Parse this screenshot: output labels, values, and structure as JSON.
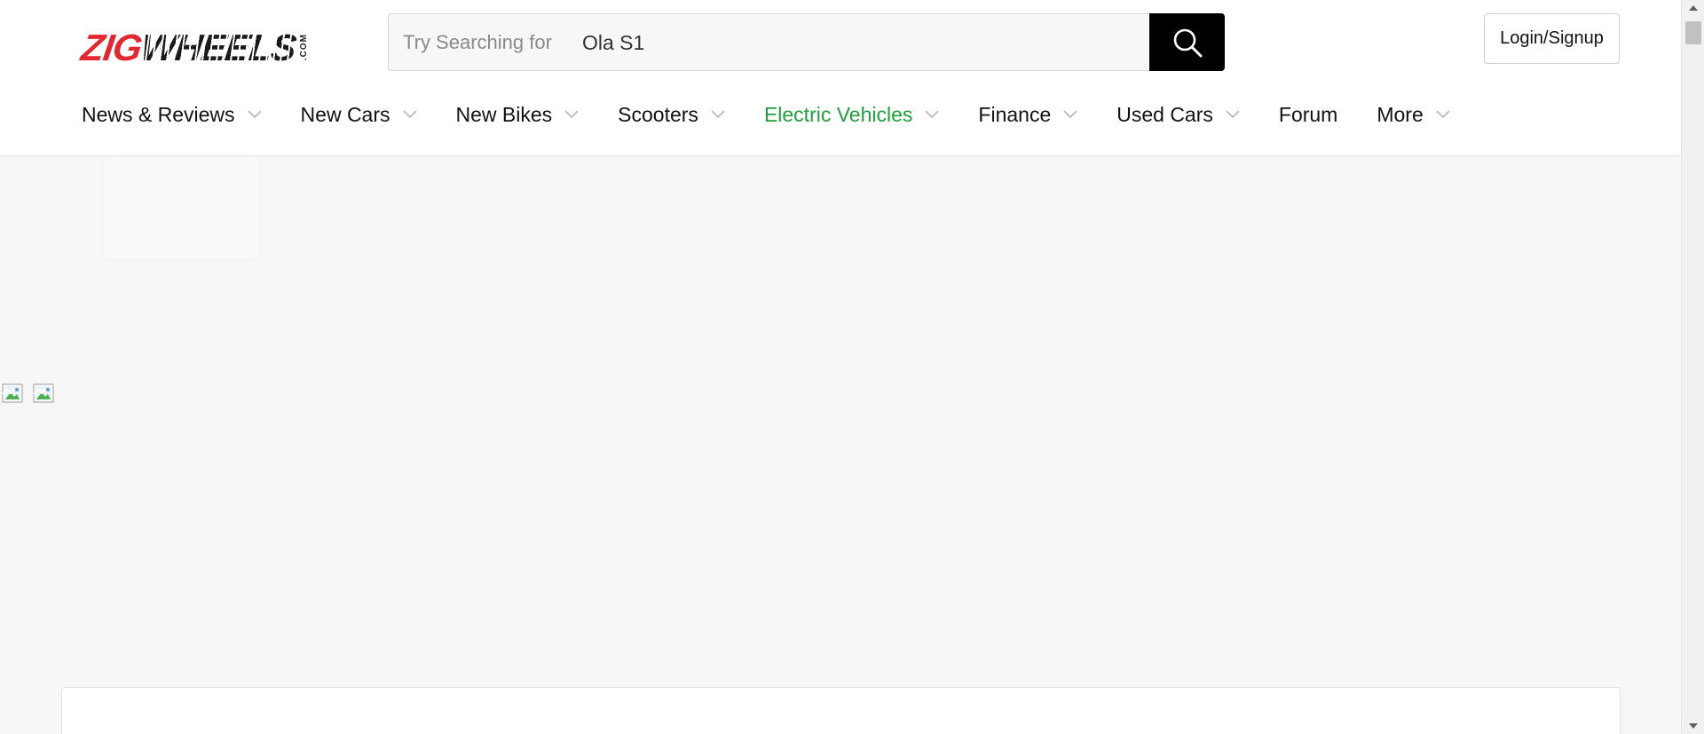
{
  "brand": {
    "logo_part1": "ZIG",
    "logo_part2": "WHEELS",
    "logo_suffix": ".COM",
    "accent_color": "#e4262f"
  },
  "search": {
    "label": "Try Searching for",
    "value": "Ola S1",
    "button_icon": "search-icon"
  },
  "header": {
    "login_label": "Login/Signup"
  },
  "nav": {
    "items": [
      {
        "label": "News & Reviews",
        "has_dropdown": true
      },
      {
        "label": "New Cars",
        "has_dropdown": true
      },
      {
        "label": "New Bikes",
        "has_dropdown": true
      },
      {
        "label": "Scooters",
        "has_dropdown": true
      },
      {
        "label": "Electric Vehicles",
        "has_dropdown": true,
        "active": true,
        "color": "#20a03a"
      },
      {
        "label": "Finance",
        "has_dropdown": true
      },
      {
        "label": "Used Cars",
        "has_dropdown": true
      },
      {
        "label": "Forum",
        "has_dropdown": false
      },
      {
        "label": "More",
        "has_dropdown": true
      }
    ]
  },
  "icons": {
    "broken_image_1": "broken-image-icon",
    "broken_image_2": "broken-image-icon"
  }
}
